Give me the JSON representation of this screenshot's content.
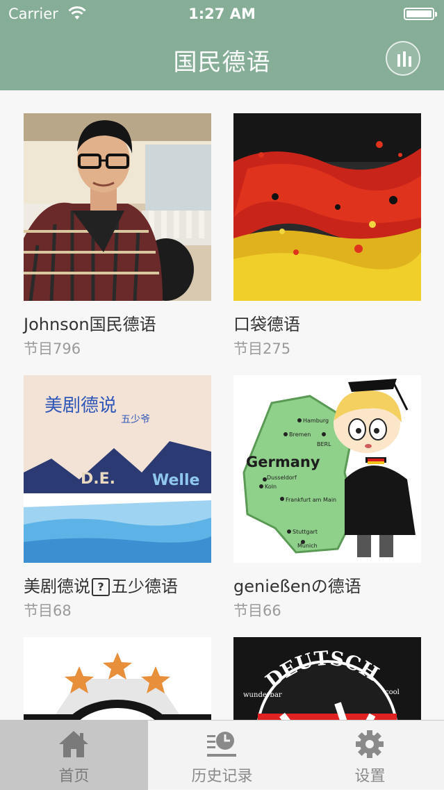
{
  "status_bar": {
    "carrier": "Carrier",
    "time": "1:27 AM"
  },
  "nav": {
    "title": "国民德语",
    "player_icon": "audio-bars-icon"
  },
  "colors": {
    "header": "#86ae97",
    "text": "#333333",
    "subtext": "#9a9a9a",
    "tab_active": "#c6c6c6"
  },
  "cards": [
    {
      "title": "Johnson国民德语",
      "count": "节目796",
      "thumb": "portrait-photo"
    },
    {
      "title": "口袋德语",
      "count": "节目275",
      "thumb": "german-flag-paint"
    },
    {
      "title_a": "美剧德说",
      "title_b": "五少德语",
      "title_glyph": "?",
      "count": "节目68",
      "thumb": "dewelle-illustration",
      "thumb_text": {
        "heading": "美剧德说",
        "sign": "五少爷",
        "de": "D.E.",
        "welle": "Welle"
      }
    },
    {
      "title": "genießenの德语",
      "count": "节目66",
      "thumb": "germany-map-cartoon",
      "thumb_text": {
        "country": "Germany",
        "cities": [
          "Hamburg",
          "Bremen",
          "BERL",
          "Dusseldorf",
          "Koln",
          "Frankfurt am Main",
          "Stuttgart",
          "Munich"
        ]
      }
    },
    {
      "title": "",
      "count": "",
      "thumb": "stars-badge"
    },
    {
      "title": "",
      "count": "",
      "thumb": "deutsch-badge",
      "thumb_text": {
        "word": "DEUTSCH",
        "left": "wunderbar",
        "right": "cool"
      }
    }
  ],
  "tabs": [
    {
      "label": "首页",
      "icon": "home-icon",
      "active": true
    },
    {
      "label": "历史记录",
      "icon": "history-clock-icon",
      "active": false
    },
    {
      "label": "设置",
      "icon": "gear-icon",
      "active": false
    }
  ]
}
